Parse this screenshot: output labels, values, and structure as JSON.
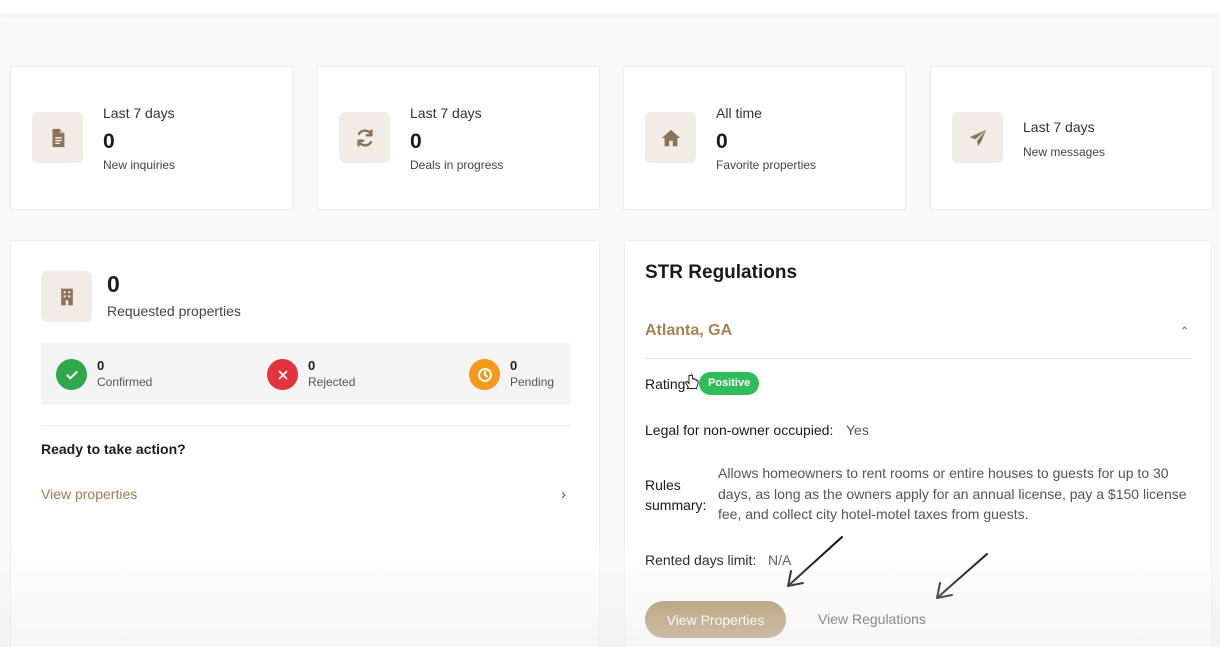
{
  "stats": [
    {
      "period": "Last 7 days",
      "value": "0",
      "label": "New inquiries",
      "icon": "document-icon"
    },
    {
      "period": "Last 7 days",
      "value": "0",
      "label": "Deals in progress",
      "icon": "refresh-icon"
    },
    {
      "period": "All time",
      "value": "0",
      "label": "Favorite properties",
      "icon": "home-icon"
    },
    {
      "period": "Last 7 days",
      "value": "",
      "label": "New messages",
      "icon": "paper-plane-icon"
    }
  ],
  "requested": {
    "value": "0",
    "label": "Requested properties",
    "statuses": [
      {
        "count": "0",
        "label": "Confirmed",
        "color": "#2ea84a"
      },
      {
        "count": "0",
        "label": "Rejected",
        "color": "#e3343c"
      },
      {
        "count": "0",
        "label": "Pending",
        "color": "#f39a1b"
      }
    ],
    "ready_title": "Ready to take action?",
    "view_link": "View properties"
  },
  "regulations": {
    "title": "STR Regulations",
    "city": "Atlanta, GA",
    "rating_label": "Rating:",
    "rating_value": "Positive",
    "legal_label": "Legal for non-owner occupied:",
    "legal_value": "Yes",
    "rules_label_1": "Rules",
    "rules_label_2": "summary:",
    "rules_text": "Allows homeowners to rent rooms or entire houses to guests for up to 30 days, as long as the owners apply for an annual license, pay a $150 license fee, and collect city hotel-motel taxes from guests.",
    "rented_label": "Rented days limit:",
    "rented_value": "N/A",
    "button_properties": "View Properties",
    "button_regulations": "View Regulations"
  },
  "colors": {
    "accent": "#a98a58",
    "accent_text": "#a5844f",
    "icon_bg": "#f1ede6",
    "icon_fg": "#8b7355",
    "positive": "#2ebd58"
  }
}
